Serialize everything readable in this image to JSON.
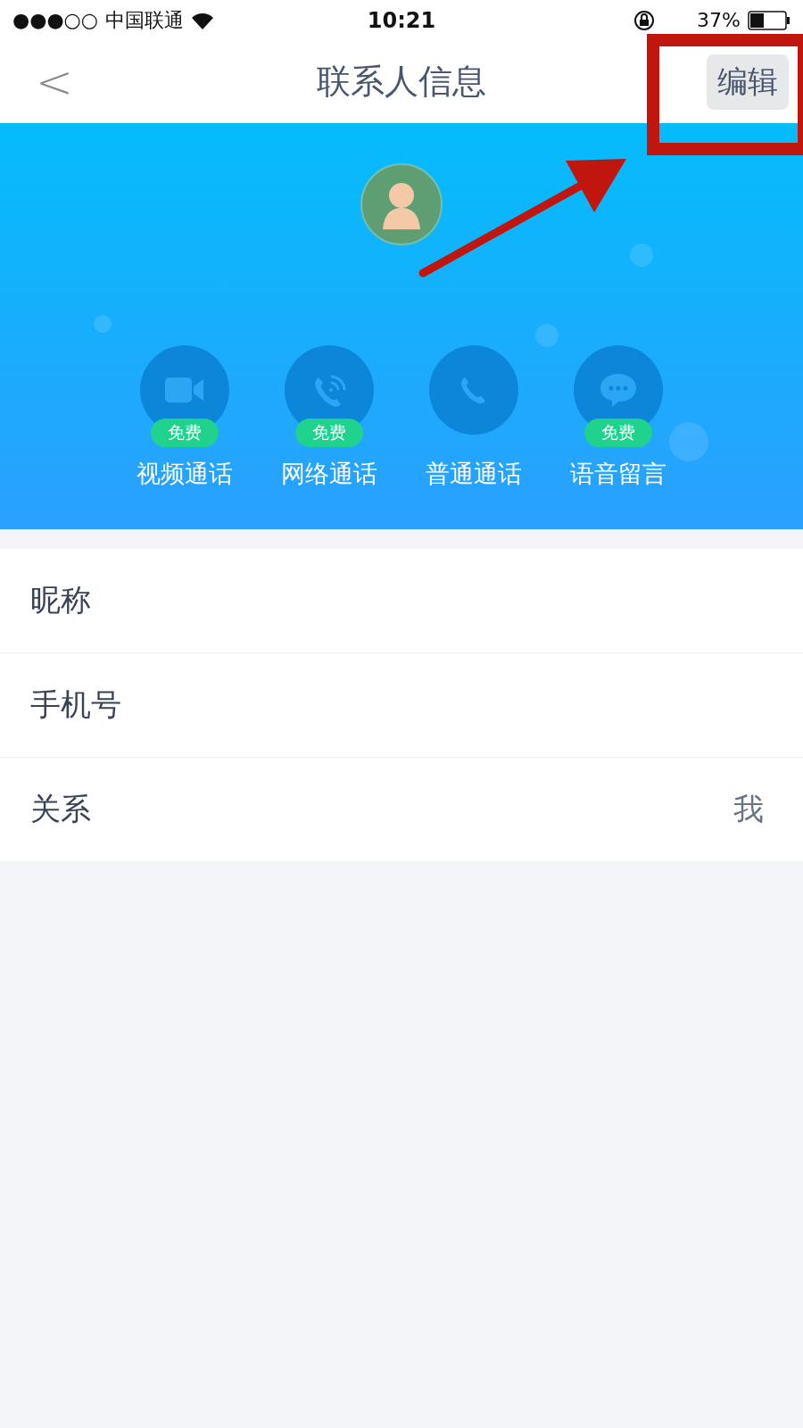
{
  "status_bar": {
    "signal": "●●●○○",
    "carrier": "中国联通",
    "time": "10:21",
    "battery": "37%"
  },
  "nav": {
    "back": "<",
    "title": "联系人信息",
    "edit": "编辑"
  },
  "actions": [
    {
      "kind": "video",
      "label": "视频通话",
      "free": true,
      "badge": "免费"
    },
    {
      "kind": "voip",
      "label": "网络通话",
      "free": true,
      "badge": "免费"
    },
    {
      "kind": "phone",
      "label": "普通通话",
      "free": false
    },
    {
      "kind": "message",
      "label": "语音留言",
      "free": true,
      "badge": "免费"
    }
  ],
  "fields": [
    {
      "label": "昵称"
    },
    {
      "label": "手机号"
    },
    {
      "label": "关系",
      "value": "我"
    }
  ],
  "annotation": {
    "highlight": true,
    "arrow": true
  }
}
